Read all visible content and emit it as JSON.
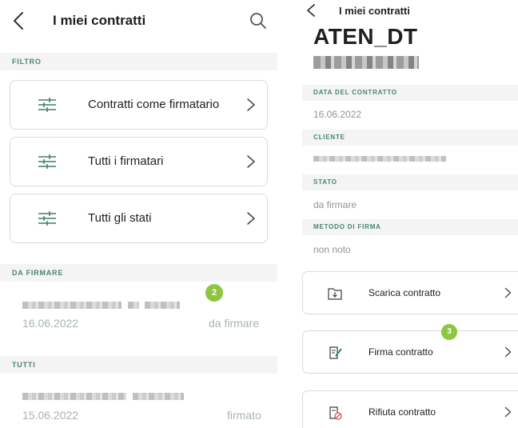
{
  "left": {
    "title": "I miei contratti",
    "filter_section": "FILTRO",
    "filters": [
      {
        "label": "Contratti come firmatario"
      },
      {
        "label": "Tutti i firmatari"
      },
      {
        "label": "Tutti gli stati"
      }
    ],
    "to_sign_section": "DA FIRMARE",
    "to_sign_item": {
      "date": "16.06.2022",
      "status": "da firmare"
    },
    "badge_left": "2",
    "all_section": "TUTTI",
    "all_item": {
      "date": "15.06.2022",
      "status": "firmato"
    }
  },
  "right": {
    "title": "I miei contratti",
    "contract_name": "ATEN_DT",
    "sections": {
      "date_label": "DATA DEL CONTRATTO",
      "date_value": "16.06.2022",
      "client_label": "CLIENTE",
      "state_label": "STATO",
      "state_value": "da firmare",
      "method_label": "METODO DI FIRMA",
      "method_value": "non noto"
    },
    "actions": [
      {
        "label": "Scarica contratto",
        "icon": "download-folder-icon"
      },
      {
        "label": "Firma contratto",
        "icon": "sign-document-icon"
      },
      {
        "label": "Rifiuta contratto",
        "icon": "reject-document-icon"
      }
    ],
    "badge_right": "3"
  },
  "colors": {
    "accent_green": "#8dc63f",
    "section_text": "#4a8572",
    "section_bg": "#f3f4f3"
  }
}
